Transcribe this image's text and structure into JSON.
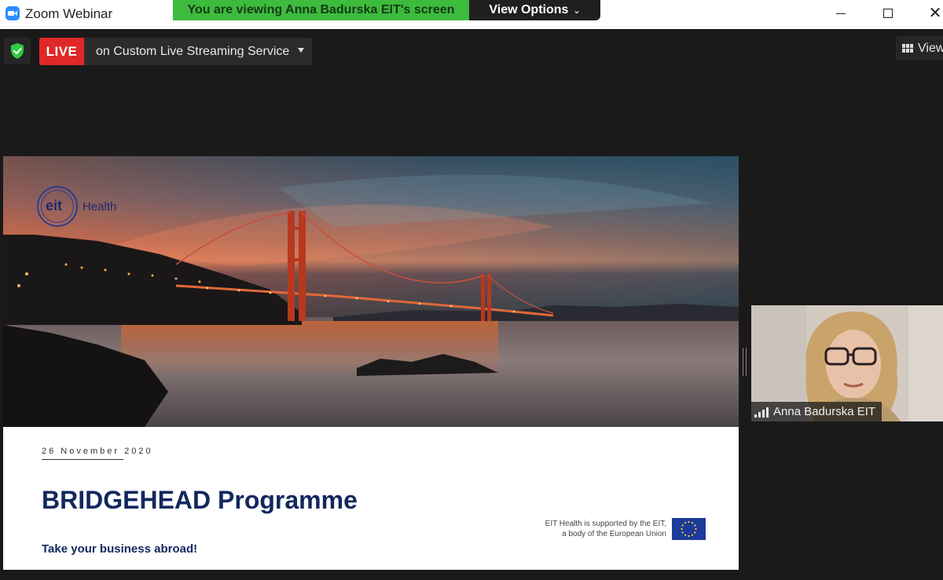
{
  "window": {
    "title": "Zoom Webinar",
    "share_banner": "You are viewing Anna Badurska EIT's screen",
    "view_options_label": "View Options",
    "view_options_chevron": "⌄",
    "minimize_icon": "minimize-icon",
    "maximize_icon": "maximize-icon",
    "close_symbol": "✕"
  },
  "toolbar": {
    "live_label": "LIVE",
    "stream_service": "on Custom Live Streaming Service",
    "view_label": "View",
    "security_icon": "shield-check-icon"
  },
  "slide": {
    "logo_eit": "eit",
    "logo_health": "Health",
    "date": "26 November 2020",
    "title": "BRIDGEHEAD Programme",
    "subtitle": "Take your business abroad!",
    "eu_line1": "EIT Health is supported by the EIT,",
    "eu_line2": "a body of the European Union"
  },
  "participant": {
    "name": "Anna Badurska EIT",
    "signal_icon": "signal-bars-icon"
  },
  "colors": {
    "live_red": "#e02828",
    "banner_green": "#3dbb3d",
    "slide_title_navy": "#12285e",
    "shield_green": "#2ecc40"
  }
}
